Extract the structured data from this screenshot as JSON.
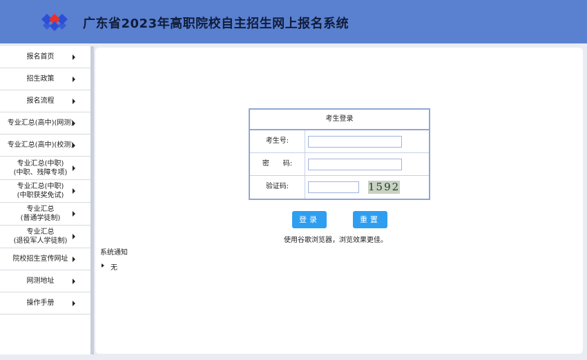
{
  "header": {
    "title": "广东省2023年高职院校自主招生网上报名系统",
    "logo_colors": [
      "#2b4fd6",
      "#e8312a"
    ]
  },
  "sidebar": {
    "items": [
      {
        "label": "报名首页"
      },
      {
        "label": "招生政策"
      },
      {
        "label": "报名流程"
      },
      {
        "label": "专业汇总(高中)(网测)"
      },
      {
        "label": "专业汇总(高中)(校测)"
      },
      {
        "label": "专业汇总(中职)\n(中职、残障专项)"
      },
      {
        "label": "专业汇总(中职)\n(中职获奖免试)"
      },
      {
        "label": "专业汇总\n(普通学徒制)"
      },
      {
        "label": "专业汇总\n(退役军人学徒制)"
      },
      {
        "label": "院校招生宣传网址"
      },
      {
        "label": "网测地址"
      },
      {
        "label": "操作手册"
      }
    ]
  },
  "login": {
    "title": "考生登录",
    "exam_no_label": "考生号:",
    "password_label": "密　　码:",
    "captcha_label": "验证码:",
    "captcha_value": "1592",
    "exam_no_value": "",
    "password_value": "",
    "captcha_input_value": "",
    "login_button": "登录",
    "reset_button": "重置",
    "hint": "使用谷歌浏览器，浏览效果更佳。"
  },
  "notice": {
    "title": "系统通知",
    "items": [
      "无"
    ]
  },
  "colors": {
    "header_bg": "#5a80d0",
    "button_bg": "#2e9ef0",
    "border": "#8ea5d6"
  }
}
